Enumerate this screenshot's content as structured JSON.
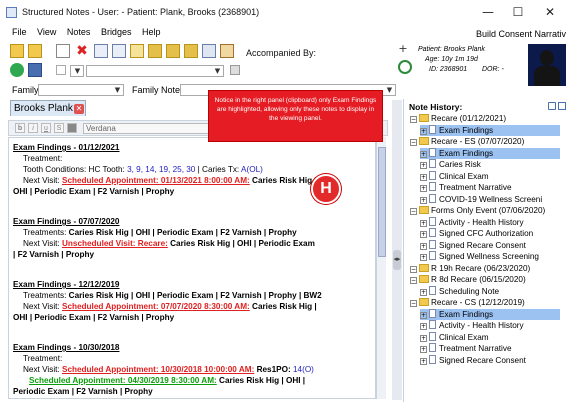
{
  "window": {
    "title": "Structured Notes - User:  - Patient: Plank, Brooks (2368901)",
    "minimize": "—",
    "maximize": "☐",
    "close": "✕",
    "build": "Build Consent Narratives"
  },
  "menu": [
    "File",
    "View",
    "Notes",
    "Bridges",
    "Help"
  ],
  "toolbar": {
    "accompanied_by": "Accompanied By:"
  },
  "patient": {
    "name": "Patient: Brooks Plank",
    "age": "Age: 10y 1m 19d",
    "id": "ID: 2368901",
    "dor": "DOR: -"
  },
  "filters": {
    "family_label": "Family:",
    "family_note_label": "Family Note:"
  },
  "tab": {
    "label": "Brooks Plank"
  },
  "editor": {
    "font": "Verdana"
  },
  "annotation": {
    "text": "Notice in the right panel (clipboard) only Exam Findings are highlighted, allowing only these notes to display in the viewing panel.",
    "marker": "H"
  },
  "notes": [
    {
      "title": "Exam Findings - 01/12/2021"
    },
    {
      "title": "Exam Findings - 07/07/2020"
    },
    {
      "title": "Exam Findings - 12/12/2019"
    },
    {
      "title": "Exam Findings - 10/30/2018"
    }
  ],
  "note_text": {
    "treatment": "Treatment:",
    "tooth_conditions": "Tooth Conditions: HC Tooth: ",
    "teeth": "3, 9, 14, 19, 25, 30",
    "caries_tx": " | Caries Tx: ",
    "caries_tx_val": "A(OL)",
    "next_visit": "Next Visit: ",
    "appt1": "Scheduled Appointment: 01/13/2021 8:00:00 AM:",
    "n1_rest": " Caries Risk Hig |",
    "n1_line2": "OHI | Periodic Exam | F2 Varnish | Prophy",
    "treatments_label": "Treatments: ",
    "n2_treat": "Caries Risk Hig | OHI | Periodic Exam | F2 Varnish | Prophy",
    "appt2": "Unscheduled Visit: Recare:",
    "n2_rest": " Caries Risk Hig | OHI | Periodic Exam",
    "n2_line3": "| F2 Varnish | Prophy",
    "n3_treat": "Caries Risk Hig | OHI | Periodic Exam | F2 Varnish | Prophy | BW2",
    "appt3": "Scheduled Appointment: 07/07/2020 8:30:00 AM:",
    "n3_rest": " Caries Risk Hig |",
    "n3_line3": "OHI | Periodic Exam | F2 Varnish | Prophy",
    "appt4": "Scheduled Appointment: 10/30/2018 10:00:00 AM:",
    "n4_rest": " Res1PO: ",
    "n4_code": "14(O)",
    "appt5": "Scheduled Appointment: 04/30/2019 8:30:00 AM:",
    "n4_rest2": " Caries Risk Hig | OHI |",
    "n4_line3": "Periodic Exam | F2 Varnish | Prophy"
  },
  "history": {
    "title": "Note History:",
    "items": [
      {
        "label": "Recare (01/12/2021)",
        "kind": "folder",
        "selected": false
      },
      {
        "label": "Exam Findings",
        "kind": "doc",
        "selected": true
      },
      {
        "label": "Recare - ES (07/07/2020)",
        "kind": "folder",
        "selected": false
      },
      {
        "label": "Exam Findings",
        "kind": "doc",
        "selected": true
      },
      {
        "label": "Caries Risk",
        "kind": "doc",
        "selected": false
      },
      {
        "label": "Clinical Exam",
        "kind": "doc",
        "selected": false
      },
      {
        "label": "Treatment Narrative",
        "kind": "doc",
        "selected": false
      },
      {
        "label": "COVID-19 Wellness Screeni",
        "kind": "doc",
        "selected": false
      },
      {
        "label": "Forms Only Event (07/06/2020)",
        "kind": "folder",
        "selected": false
      },
      {
        "label": "Activity - Health History",
        "kind": "doc",
        "selected": false
      },
      {
        "label": "Signed CFC Authorization",
        "kind": "doc",
        "selected": false
      },
      {
        "label": "Signed Recare Consent",
        "kind": "doc",
        "selected": false
      },
      {
        "label": "Signed Wellness Screening",
        "kind": "doc",
        "selected": false
      },
      {
        "label": "R 19h Recare (06/23/2020)",
        "kind": "folder",
        "selected": false
      },
      {
        "label": "R 8d Recare (06/15/2020)",
        "kind": "folder",
        "selected": false
      },
      {
        "label": "Scheduling Note",
        "kind": "doc",
        "selected": false
      },
      {
        "label": "Recare - CS (12/12/2019)",
        "kind": "folder",
        "selected": false
      },
      {
        "label": "Exam Findings",
        "kind": "doc",
        "selected": true
      },
      {
        "label": "Activity - Health History",
        "kind": "doc",
        "selected": false
      },
      {
        "label": "Clinical Exam",
        "kind": "doc",
        "selected": false
      },
      {
        "label": "Treatment Narrative",
        "kind": "doc",
        "selected": false
      },
      {
        "label": "Signed Recare Consent",
        "kind": "doc",
        "selected": false
      }
    ]
  }
}
